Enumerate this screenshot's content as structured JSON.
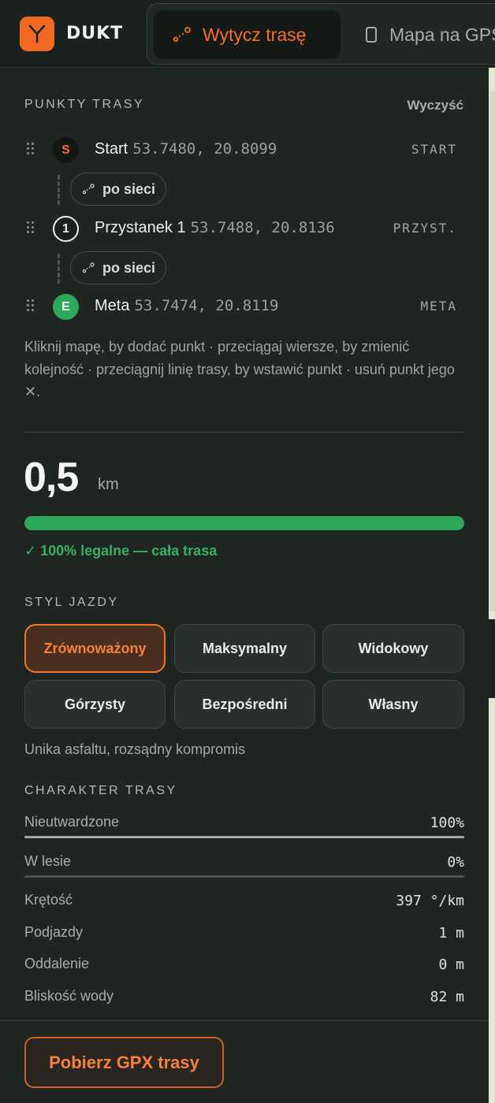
{
  "app": {
    "name": "DUKT",
    "logo_letter": "Y",
    "accent": "#f26a21"
  },
  "tabs": [
    {
      "label": "Wytycz trasę",
      "icon": "route-icon",
      "active": true
    },
    {
      "label": "Mapa na GPS",
      "icon": "phone-icon",
      "active": false
    }
  ],
  "waypoints_section": {
    "title": "PUNKTY TRASY",
    "clear_label": "Wyczyść",
    "points": [
      {
        "badge": "S",
        "name": "Start",
        "coords": "53.7480, 20.8099",
        "tag": "START"
      },
      {
        "badge": "1",
        "name": "Przystanek 1",
        "coords": "53.7488, 20.8136",
        "tag": "PRZYST."
      },
      {
        "badge": "E",
        "name": "Meta",
        "coords": "53.7474, 20.8119",
        "tag": "META"
      }
    ],
    "segments": [
      {
        "label": "po sieci"
      },
      {
        "label": "po sieci"
      }
    ],
    "hint": "Kliknij mapę, by dodać punkt · przeciągaj wiersze, by zmienić kolejność · przeciągnij linię trasy, by wstawić punkt · usuń punkt jego ✕."
  },
  "summary": {
    "distance": "0,5",
    "unit": "km",
    "legal_fraction": 1.0,
    "legal_text": "✓ 100% legalne — cała trasa"
  },
  "riding_style": {
    "title": "STYL JAZDY",
    "options": [
      "Zrównoważony",
      "Maksymalny",
      "Widokowy",
      "Górzysty",
      "Bezpośredni",
      "Własny"
    ],
    "selected": "Zrównoważony",
    "description": "Unika asfaltu, rozsądny kompromis"
  },
  "character": {
    "title": "CHARAKTER TRASY",
    "bars": [
      {
        "label": "Nieutwardzone",
        "value": "100%",
        "fraction": 1.0
      },
      {
        "label": "W lesie",
        "value": "0%",
        "fraction": 0.0
      }
    ],
    "stats": [
      {
        "label": "Krętość",
        "value": "397 °/km"
      },
      {
        "label": "Podjazdy",
        "value": "1 m"
      },
      {
        "label": "Oddalenie",
        "value": "0 m"
      },
      {
        "label": "Bliskość wody",
        "value": "82 m"
      }
    ]
  },
  "download": {
    "label": "Pobierz GPX trasy"
  }
}
